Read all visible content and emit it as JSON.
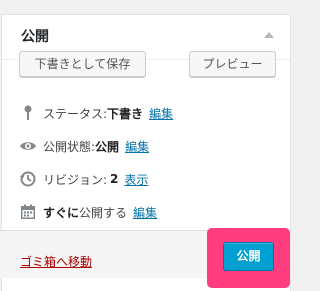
{
  "panel": {
    "title": "公開"
  },
  "actions": {
    "save_draft_label": "下書きとして保存",
    "preview_label": "プレビュー"
  },
  "status": {
    "label": "ステータス:",
    "value": "下書き",
    "edit_label": "編集"
  },
  "visibility": {
    "label": "公開状態:",
    "value": "公開",
    "edit_label": "編集"
  },
  "revisions": {
    "label": "リビジョン:",
    "count": "2",
    "view_label": "表示"
  },
  "schedule": {
    "emphasis": "すぐに",
    "label": "公開する",
    "edit_label": "編集"
  },
  "footer": {
    "trash_label": "ゴミ箱へ移動",
    "publish_label": "公開"
  },
  "colors": {
    "link": "#0073aa",
    "trash": "#a00000",
    "publish": "#00a0d2",
    "highlight": "#ff3d7f"
  }
}
